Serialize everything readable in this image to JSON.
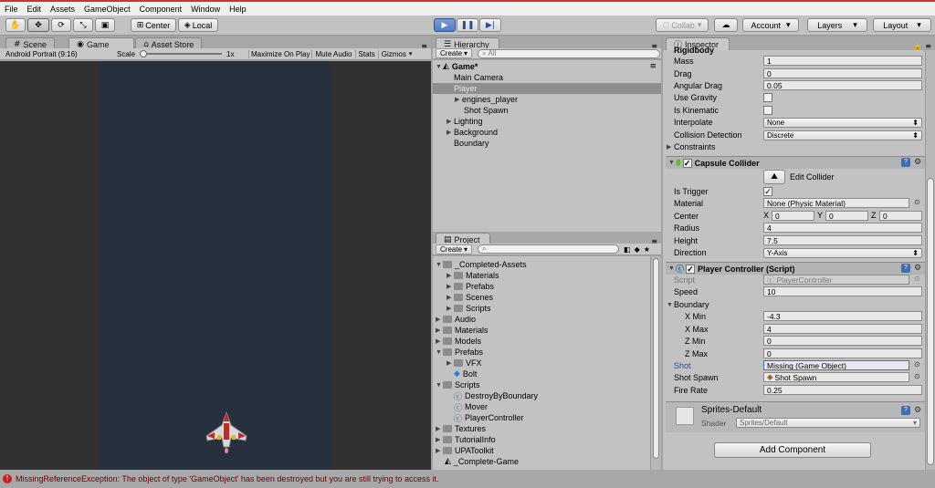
{
  "menu": [
    "File",
    "Edit",
    "Assets",
    "GameObject",
    "Component",
    "Window",
    "Help"
  ],
  "toolbar": {
    "pivot_center": "Center",
    "pivot_local": "Local",
    "collab": "Collab",
    "account": "Account",
    "layers": "Layers",
    "layout": "Layout"
  },
  "scene_tabs": {
    "scene": "Scene",
    "game": "Game",
    "asset_store": "Asset Store"
  },
  "game_bar": {
    "aspect": "Android Portrait (9:16)",
    "scale_label": "Scale",
    "scale_value": "1x",
    "maximize": "Maximize On Play",
    "mute": "Mute Audio",
    "stats": "Stats",
    "gizmos": "Gizmos"
  },
  "hierarchy": {
    "tab": "Hierarchy",
    "create": "Create",
    "search_placeholder": "All",
    "scene": "Game*",
    "items": [
      "Main Camera",
      "Player",
      "engines_player",
      "Shot Spawn",
      "Lighting",
      "Background",
      "Boundary"
    ]
  },
  "project": {
    "tab": "Project",
    "create": "Create",
    "items": [
      "_Completed-Assets",
      "Materials",
      "Prefabs",
      "Scenes",
      "Scripts",
      "Audio",
      "Materials",
      "Models",
      "Prefabs",
      "VFX",
      "Bolt",
      "Scripts",
      "DestroyByBoundary",
      "Mover",
      "PlayerController",
      "Textures",
      "TutorialInfo",
      "UPAToolkit",
      "_Complete-Game"
    ]
  },
  "inspector": {
    "tab": "Inspector",
    "rigidbody": {
      "title": "Rigidbody",
      "mass_label": "Mass",
      "mass": "1",
      "drag_label": "Drag",
      "drag": "0",
      "angdrag_label": "Angular Drag",
      "angdrag": "0.05",
      "gravity_label": "Use Gravity",
      "kinematic_label": "Is Kinematic",
      "interp_label": "Interpolate",
      "interp": "None",
      "collision_label": "Collision Detection",
      "collision": "Discrete",
      "constraints_label": "Constraints"
    },
    "capsule": {
      "title": "Capsule Collider",
      "edit": "Edit Collider",
      "trigger_label": "Is Trigger",
      "material_label": "Material",
      "material": "None (Physic Material)",
      "center_label": "Center",
      "cx": "0",
      "cy": "0",
      "cz": "0",
      "radius_label": "Radius",
      "radius": "4",
      "height_label": "Height",
      "height": "7.5",
      "direction_label": "Direction",
      "direction": "Y-Axis"
    },
    "player": {
      "title": "Player Controller (Script)",
      "script_label": "Script",
      "script": "PlayerController",
      "speed_label": "Speed",
      "speed": "10",
      "boundary_label": "Boundary",
      "xmin_label": "X Min",
      "xmin": "-4.3",
      "xmax_label": "X Max",
      "xmax": "4",
      "zmin_label": "Z Min",
      "zmin": "0",
      "zmax_label": "Z Max",
      "zmax": "0",
      "shot_label": "Shot",
      "shot": "Missing (Game Object)",
      "shotspawn_label": "Shot Spawn",
      "shotspawn": "Shot Spawn",
      "firerate_label": "Fire Rate",
      "firerate": "0.25"
    },
    "material": {
      "name": "Sprites-Default",
      "shader_label": "Shader",
      "shader": "Sprites/Default"
    },
    "add_component": "Add Component"
  },
  "status": "MissingReferenceException: The object of type 'GameObject' has been destroyed but you are still trying to access it."
}
